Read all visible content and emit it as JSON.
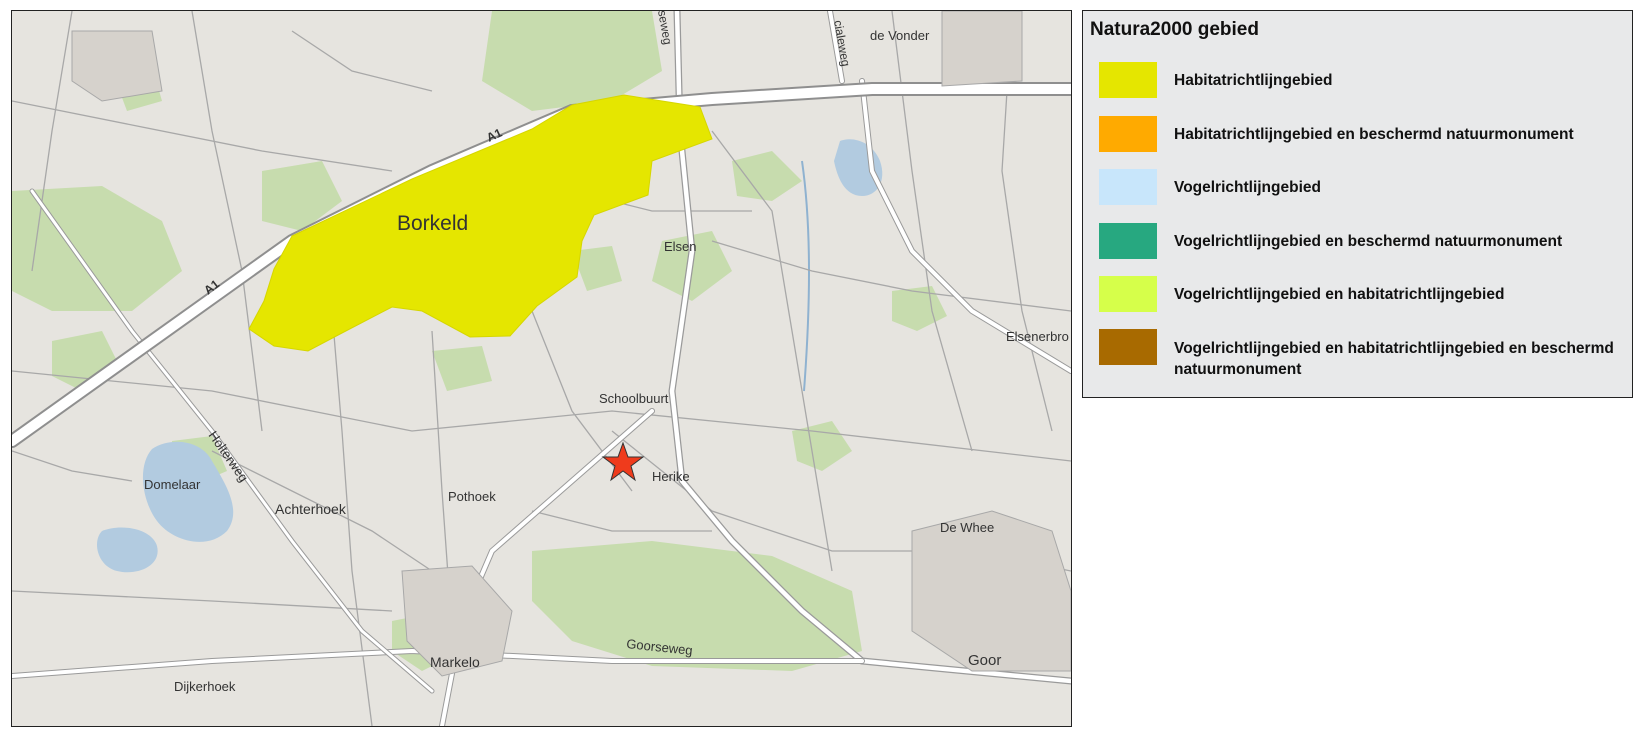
{
  "map": {
    "area_label": "Borkeld",
    "highway_label": "A1",
    "roads": {
      "holterweg": "Holterweg",
      "goorseweg": "Goorseweg",
      "eseweg_partial": "seweg",
      "cialeweg_partial": "cialeweg"
    },
    "places": {
      "de_vonder": "de Vonder",
      "elsen": "Elsen",
      "elsenerbro_partial": "Elsenerbro",
      "schoolbuurt": "Schoolbuurt",
      "herike": "Herike",
      "pothoek": "Pothoek",
      "achterhoek": "Achterhoek",
      "domelaar": "Domelaar",
      "de_whee": "De Whee",
      "markelo": "Markelo",
      "goor": "Goor",
      "dijkerhoek": "Dijkerhoek"
    },
    "colors": {
      "background": "#e6e4df",
      "forest": "#c7dcae",
      "water": "#b2cbe0",
      "road": "#ffffff",
      "road_casing": "#9a9a9a",
      "habitat_area": "#e5e600",
      "marker": "#ef3b1c"
    },
    "marker_icon": "star-icon"
  },
  "legend": {
    "title": "Natura2000 gebied",
    "items": [
      {
        "label": "Habitatrichtlijngebied",
        "color": "#e5e600"
      },
      {
        "label": "Habitatrichtlijngebied en beschermd natuurmonument",
        "color": "#ffaa00"
      },
      {
        "label": "Vogelrichtlijngebied",
        "color": "#c8e6fb"
      },
      {
        "label": "Vogelrichtlijngebied en beschermd natuurmonument",
        "color": "#27a880"
      },
      {
        "label": "Vogelrichtlijngebied en habitatrichtlijngebied",
        "color": "#d6ff4a"
      },
      {
        "label": "Vogelrichtlijngebied en habitatrichtlijngebied en beschermd natuurmonument",
        "color": "#a86a00"
      }
    ]
  }
}
